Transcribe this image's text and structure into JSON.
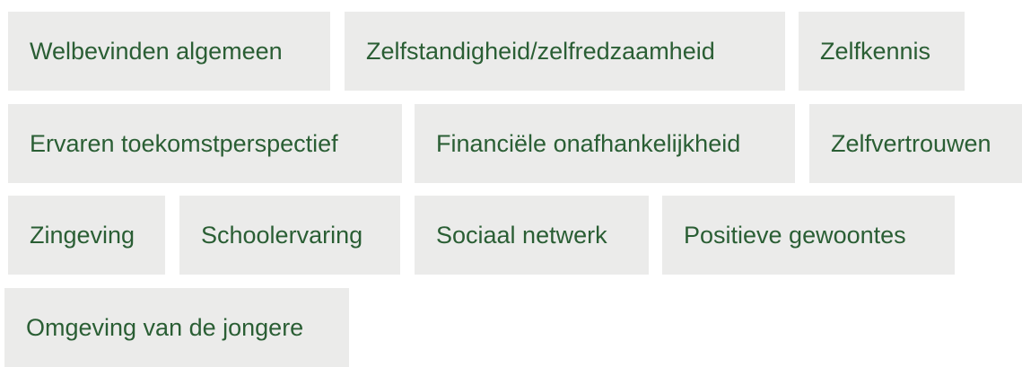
{
  "tags": [
    {
      "label": "Welbevinden algemeen"
    },
    {
      "label": "Zelfstandigheid/zelfredzaamheid"
    },
    {
      "label": "Zelfkennis"
    },
    {
      "label": "Ervaren toekomstperspectief"
    },
    {
      "label": "Financiële onafhankelijkheid"
    },
    {
      "label": "Zelfvertrouwen"
    },
    {
      "label": "Zingeving"
    },
    {
      "label": "Schoolervaring"
    },
    {
      "label": "Sociaal netwerk"
    },
    {
      "label": "Positieve gewoontes"
    },
    {
      "label": "Omgeving van de jongere"
    }
  ],
  "colors": {
    "tag_background": "#ebebea",
    "tag_text": "#2a5e34",
    "page_background": "#ffffff"
  }
}
